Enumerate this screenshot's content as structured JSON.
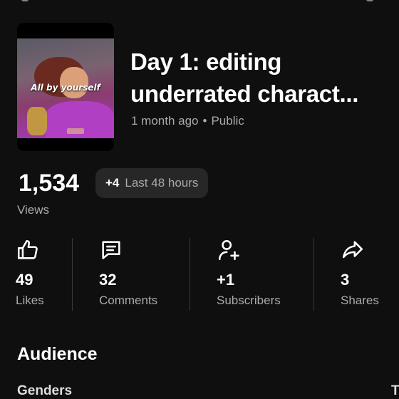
{
  "video": {
    "thumbnail_caption": "All by yourself",
    "title_line1": "Day 1: editing",
    "title_line2": "underrated charact...",
    "age": "1 month ago",
    "separator": "•",
    "visibility": "Public"
  },
  "views": {
    "count": "1,534",
    "label": "Views",
    "delta": "+4",
    "window": "Last 48 hours"
  },
  "metrics": [
    {
      "icon": "thumbs-up-icon",
      "value": "49",
      "label": "Likes"
    },
    {
      "icon": "comment-icon",
      "value": "32",
      "label": "Comments"
    },
    {
      "icon": "add-person-icon",
      "value": "+1",
      "label": "Subscribers"
    },
    {
      "icon": "share-icon",
      "value": "3",
      "label": "Shares"
    }
  ],
  "audience": {
    "heading": "Audience",
    "genders_label": "Genders",
    "next_card_letter": "T"
  },
  "colors": {
    "background": "#0f0f0f",
    "text": "#ffffff",
    "secondary_text": "#aaaaaa",
    "pill_bg": "#272727"
  }
}
